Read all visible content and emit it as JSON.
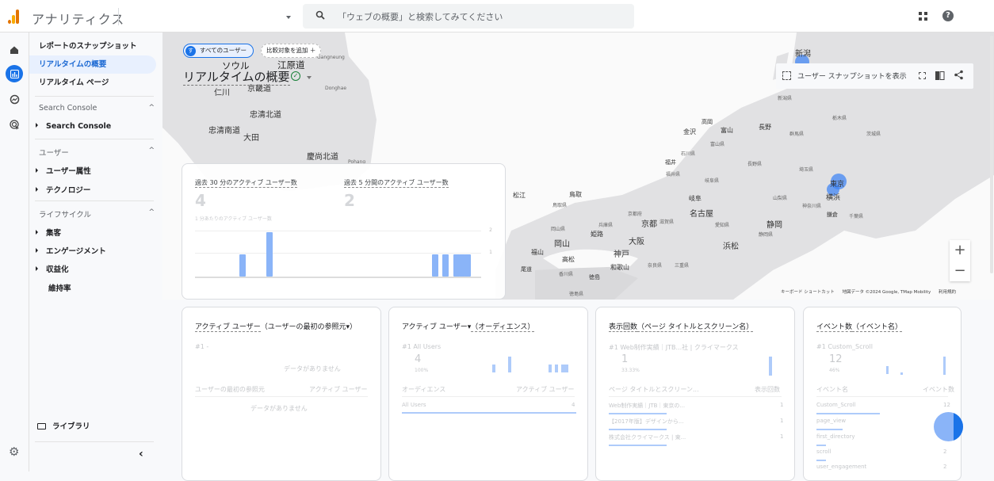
{
  "header": {
    "app_title": "アナリティクス",
    "search_placeholder": "「ウェブの概要」と検索してみてください",
    "help_glyph": "?"
  },
  "sidebar": {
    "top_items": [
      {
        "label": "レポートのスナップショット",
        "active": false
      },
      {
        "label": "リアルタイムの概要",
        "active": true
      },
      {
        "label": "リアルタイム ページ",
        "active": false
      }
    ],
    "sections": [
      {
        "title": "Search Console",
        "items": [
          {
            "label": "Search Console",
            "expandable": true
          }
        ]
      },
      {
        "title": "ユーザー",
        "items": [
          {
            "label": "ユーザー属性",
            "expandable": true
          },
          {
            "label": "テクノロジー",
            "expandable": true
          }
        ]
      },
      {
        "title": "ライフサイクル",
        "items": [
          {
            "label": "集客",
            "expandable": true
          },
          {
            "label": "エンゲージメント",
            "expandable": true
          },
          {
            "label": "収益化",
            "expandable": true
          },
          {
            "label": "維持率",
            "expandable": false
          }
        ]
      }
    ],
    "library_label": "ライブラリ",
    "collapse_glyph": "‹",
    "chevron_glyph": "^"
  },
  "main": {
    "segment_chip": {
      "badge": "す",
      "label": "すべてのユーザー"
    },
    "add_comparison_label": "比較対象を追加 ＋",
    "page_title": "リアルタイムの概要",
    "toolbar": {
      "snapshot_label": "ユーザー スナップショットを表示"
    },
    "map": {
      "labels_large": [
        "ソウル",
        "江原道",
        "京畿道",
        "忠清北道",
        "忠清南道",
        "大田",
        "慶尚北道",
        "仁川",
        "新潟",
        "金沢",
        "富山",
        "長野",
        "松江",
        "鳥取",
        "岐阜",
        "名古屋",
        "京都",
        "大阪",
        "神戸",
        "岡山",
        "姫路",
        "福山",
        "高松",
        "和歌山",
        "静岡",
        "浜松",
        "東京",
        "横浜",
        "鎌倉",
        "高岡",
        "福井",
        "徳島",
        "尾道"
      ],
      "labels_small": [
        "新潟県",
        "富山県",
        "石川県",
        "福井県",
        "岐阜県",
        "長野県",
        "群馬県",
        "栃木県",
        "茨城県",
        "埼玉県",
        "山梨県",
        "神奈川県",
        "千葉県",
        "愛知県",
        "静岡県",
        "京都府",
        "滋賀県",
        "兵庫県",
        "鳥取県",
        "岡山県",
        "香川県",
        "奈良県",
        "三重県",
        "徳島県",
        "Donghae",
        "Gangneung",
        "Pohang"
      ],
      "zoom_in": "+",
      "zoom_out": "−",
      "attribution": [
        "キーボード ショートカット",
        "地図データ ©2024 Google, TMap Mobility",
        "利用規約"
      ]
    },
    "realtime_card": {
      "metric1_label": "過去 30 分のアクティブ ユーザー数",
      "metric1_value": "4",
      "metric2_label": "過去 5 分間のアクティブ ユーザー数",
      "metric2_value": "2",
      "chart_subtitle": "1 分あたりのアクティブ ユーザー数",
      "y_ticks": [
        "2",
        "1"
      ],
      "bars_per_minute": [
        0,
        0,
        0,
        0,
        0,
        0,
        0,
        0,
        1,
        0,
        0,
        0,
        0,
        2,
        0,
        0,
        0,
        0,
        0,
        0,
        0,
        0,
        0,
        0,
        0,
        0,
        0,
        0,
        0,
        0,
        0,
        0,
        0,
        0,
        0,
        0,
        0,
        0,
        0,
        0,
        0,
        0,
        0,
        1,
        0,
        1,
        0,
        1,
        1,
        1,
        0,
        0
      ]
    },
    "cards": [
      {
        "title_metric": "アクティブ ユーザー",
        "title_dim": "（ユーザーの最初の参照元▾）",
        "rank_label": "#1 -",
        "no_data": "データがありません",
        "col1": "ユーザーの最初の参照元",
        "col2": "アクティブ ユーザー",
        "no_data2": "データがありません"
      },
      {
        "title_metric": "アクティブ ユーザー▾",
        "title_dim": "（オーディエンス）",
        "rank_label": "#1 All Users",
        "value": "4",
        "pct": "100%",
        "col1": "オーディエンス",
        "col2": "アクティブ ユーザー",
        "rows": [
          {
            "name": "All Users",
            "value": "4"
          }
        ]
      },
      {
        "title_metric": "表示回数",
        "title_dim": "（ページ タイトルとスクリーン名）",
        "rank_label": "#1 Web制作実績｜JTB...社 | クライマークス",
        "value": "1",
        "pct": "33.33%",
        "col1": "ページ タイトルとスクリーン...",
        "col2": "表示回数",
        "rows": [
          {
            "name": "Web制作実績｜JTB｜東京の...",
            "value": "1"
          },
          {
            "name": "【2017年版】デザインから...",
            "value": "1"
          },
          {
            "name": "株式会社クライマークス | 東...",
            "value": "1"
          }
        ]
      },
      {
        "title_metric": "イベント数",
        "title_dim": "（イベント名）",
        "rank_label": "#1 Custom_Scroll",
        "value": "12",
        "pct": "46%",
        "col1": "イベント名",
        "col2": "イベント数",
        "rows": [
          {
            "name": "Custom_Scroll",
            "value": "12"
          },
          {
            "name": "page_view",
            "value": ""
          },
          {
            "name": "first_directory",
            "value": ""
          },
          {
            "name": "scroll",
            "value": "2"
          },
          {
            "name": "user_engagement",
            "value": "2"
          }
        ]
      }
    ]
  }
}
